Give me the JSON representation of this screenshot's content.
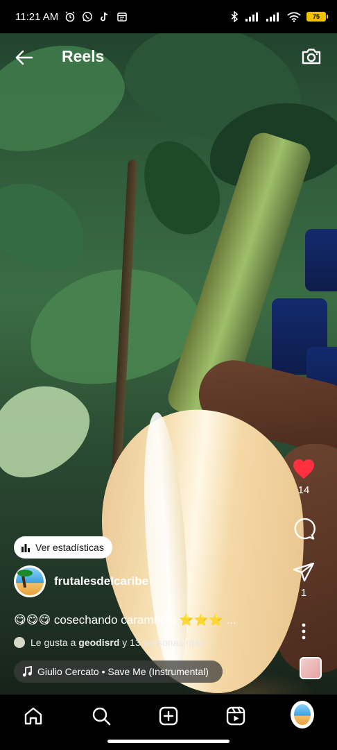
{
  "status_bar": {
    "time": "11:21 AM",
    "battery": "75",
    "left_icons": [
      "alarm-icon",
      "whatsapp-icon",
      "tiktok-icon",
      "calendar-icon"
    ],
    "right_icons": [
      "bluetooth-icon",
      "signal-icon",
      "signal-icon",
      "wifi-icon",
      "battery-icon"
    ]
  },
  "header": {
    "title": "Reels",
    "back_icon": "arrow-left-icon",
    "camera_icon": "camera-icon"
  },
  "actions": {
    "likes": "14",
    "comments": "",
    "shares": "1",
    "like_color": "#ff3040"
  },
  "post": {
    "stats_label": "Ver estadísticas",
    "username": "frutalesdelcaribe",
    "avatar_text": "Frutales del Caribe",
    "caption": "😋😋😋 cosechando carambola ⭐⭐⭐ ...",
    "likes_prefix": "Le gusta a ",
    "likes_user": "geodisrd",
    "likes_suffix": " y 13 personas más",
    "music": "Giulio Cercato • Save Me (Instrumental)"
  },
  "nav": {
    "items": [
      "home-icon",
      "search-icon",
      "create-icon",
      "reels-icon",
      "profile-avatar"
    ]
  }
}
